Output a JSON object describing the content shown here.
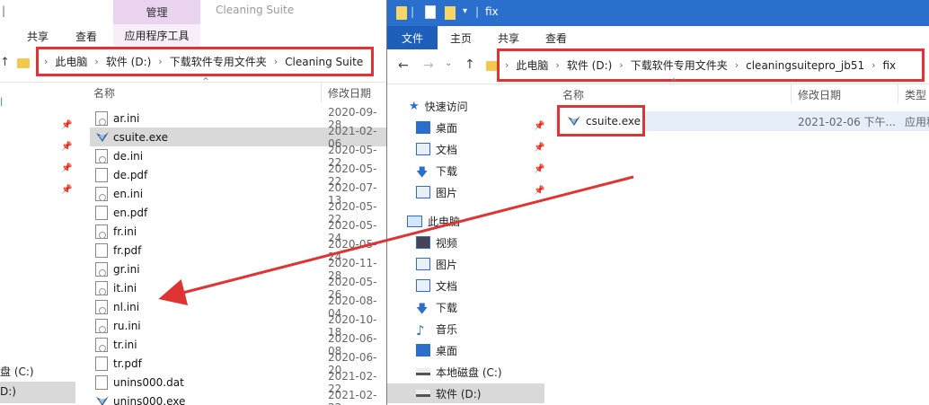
{
  "left": {
    "title": "Cleaning Suite",
    "manage_tab": "管理",
    "tabs": {
      "share": "共享",
      "view": "查看",
      "app_tools": "应用程序工具"
    },
    "breadcrumb": [
      "此电脑",
      "软件 (D:)",
      "下载软件专用文件夹",
      "Cleaning Suite"
    ],
    "columns": {
      "name": "名称",
      "modified": "修改日期"
    },
    "files": [
      {
        "name": "ar.ini",
        "date": "2020-09-28",
        "type": "ini"
      },
      {
        "name": "csuite.exe",
        "date": "2021-02-06",
        "type": "exe"
      },
      {
        "name": "de.ini",
        "date": "2020-05-22",
        "type": "ini"
      },
      {
        "name": "de.pdf",
        "date": "2020-05-22",
        "type": "doc"
      },
      {
        "name": "en.ini",
        "date": "2020-07-13",
        "type": "ini"
      },
      {
        "name": "en.pdf",
        "date": "2020-05-22",
        "type": "doc"
      },
      {
        "name": "fr.ini",
        "date": "2020-05-24",
        "type": "ini"
      },
      {
        "name": "fr.pdf",
        "date": "2020-05-24",
        "type": "doc"
      },
      {
        "name": "gr.ini",
        "date": "2020-11-28",
        "type": "ini"
      },
      {
        "name": "it.ini",
        "date": "2020-05-26",
        "type": "ini"
      },
      {
        "name": "nl.ini",
        "date": "2020-08-04",
        "type": "ini"
      },
      {
        "name": "ru.ini",
        "date": "2020-10-18",
        "type": "ini"
      },
      {
        "name": "tr.ini",
        "date": "2020-06-08",
        "type": "ini"
      },
      {
        "name": "tr.pdf",
        "date": "2020-06-20",
        "type": "doc"
      },
      {
        "name": "unins000.dat",
        "date": "2021-02-22",
        "type": "doc"
      },
      {
        "name": "unins000.exe",
        "date": "2021-02-22",
        "type": "exe"
      }
    ],
    "nav_partial": {
      "disk_c": "盘 (C:)",
      "disk_d": "D:)"
    }
  },
  "right": {
    "title": "fix",
    "tabs": {
      "file": "文件",
      "home": "主页",
      "share": "共享",
      "view": "查看"
    },
    "breadcrumb": [
      "此电脑",
      "软件 (D:)",
      "下载软件专用文件夹",
      "cleaningsuitepro_jb51",
      "fix"
    ],
    "columns": {
      "name": "名称",
      "modified": "修改日期",
      "type": "类型"
    },
    "files": [
      {
        "name": "csuite.exe",
        "date": "2021-02-06 下午...",
        "type": "应用程"
      }
    ],
    "nav": {
      "quick_access": "快速访问",
      "quick_items": [
        "桌面",
        "文档",
        "下载",
        "图片"
      ],
      "this_pc": "此电脑",
      "pc_items": [
        "视频",
        "图片",
        "文档",
        "下载",
        "音乐",
        "桌面",
        "本地磁盘 (C:)",
        "软件 (D:)"
      ]
    }
  },
  "colors": {
    "highlight": "#e03333",
    "titlebar": "#2b6fcd",
    "selected": "#d9d9d9",
    "manage": "#e9d3ef"
  }
}
